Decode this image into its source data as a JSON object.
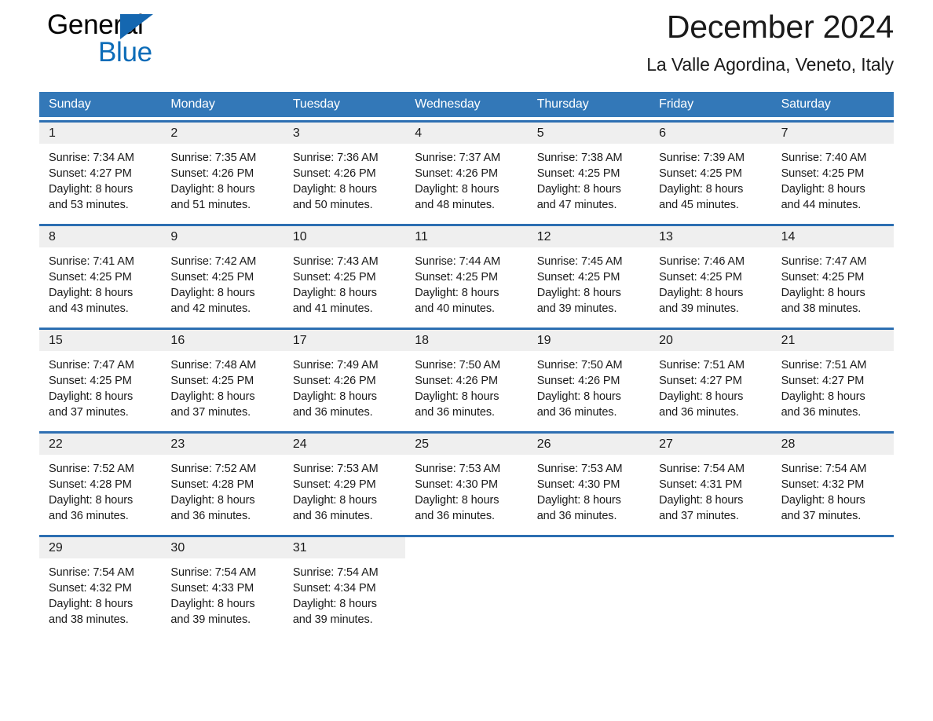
{
  "brand": {
    "name_part1": "General",
    "name_part2": "Blue",
    "triangle_color": "#1567b0",
    "blue_color": "#0c6cb8"
  },
  "header": {
    "title": "December 2024",
    "subtitle": "La Valle Agordina, Veneto, Italy"
  },
  "theme": {
    "header_bar_color": "#3378b8",
    "week_rule_color": "#2d6fb2",
    "daynum_band_color": "#efefef"
  },
  "calendar": {
    "weekdays": [
      "Sunday",
      "Monday",
      "Tuesday",
      "Wednesday",
      "Thursday",
      "Friday",
      "Saturday"
    ],
    "weeks": [
      [
        {
          "day": "1",
          "sunrise": "Sunrise: 7:34 AM",
          "sunset": "Sunset: 4:27 PM",
          "daylight": "Daylight: 8 hours and 53 minutes."
        },
        {
          "day": "2",
          "sunrise": "Sunrise: 7:35 AM",
          "sunset": "Sunset: 4:26 PM",
          "daylight": "Daylight: 8 hours and 51 minutes."
        },
        {
          "day": "3",
          "sunrise": "Sunrise: 7:36 AM",
          "sunset": "Sunset: 4:26 PM",
          "daylight": "Daylight: 8 hours and 50 minutes."
        },
        {
          "day": "4",
          "sunrise": "Sunrise: 7:37 AM",
          "sunset": "Sunset: 4:26 PM",
          "daylight": "Daylight: 8 hours and 48 minutes."
        },
        {
          "day": "5",
          "sunrise": "Sunrise: 7:38 AM",
          "sunset": "Sunset: 4:25 PM",
          "daylight": "Daylight: 8 hours and 47 minutes."
        },
        {
          "day": "6",
          "sunrise": "Sunrise: 7:39 AM",
          "sunset": "Sunset: 4:25 PM",
          "daylight": "Daylight: 8 hours and 45 minutes."
        },
        {
          "day": "7",
          "sunrise": "Sunrise: 7:40 AM",
          "sunset": "Sunset: 4:25 PM",
          "daylight": "Daylight: 8 hours and 44 minutes."
        }
      ],
      [
        {
          "day": "8",
          "sunrise": "Sunrise: 7:41 AM",
          "sunset": "Sunset: 4:25 PM",
          "daylight": "Daylight: 8 hours and 43 minutes."
        },
        {
          "day": "9",
          "sunrise": "Sunrise: 7:42 AM",
          "sunset": "Sunset: 4:25 PM",
          "daylight": "Daylight: 8 hours and 42 minutes."
        },
        {
          "day": "10",
          "sunrise": "Sunrise: 7:43 AM",
          "sunset": "Sunset: 4:25 PM",
          "daylight": "Daylight: 8 hours and 41 minutes."
        },
        {
          "day": "11",
          "sunrise": "Sunrise: 7:44 AM",
          "sunset": "Sunset: 4:25 PM",
          "daylight": "Daylight: 8 hours and 40 minutes."
        },
        {
          "day": "12",
          "sunrise": "Sunrise: 7:45 AM",
          "sunset": "Sunset: 4:25 PM",
          "daylight": "Daylight: 8 hours and 39 minutes."
        },
        {
          "day": "13",
          "sunrise": "Sunrise: 7:46 AM",
          "sunset": "Sunset: 4:25 PM",
          "daylight": "Daylight: 8 hours and 39 minutes."
        },
        {
          "day": "14",
          "sunrise": "Sunrise: 7:47 AM",
          "sunset": "Sunset: 4:25 PM",
          "daylight": "Daylight: 8 hours and 38 minutes."
        }
      ],
      [
        {
          "day": "15",
          "sunrise": "Sunrise: 7:47 AM",
          "sunset": "Sunset: 4:25 PM",
          "daylight": "Daylight: 8 hours and 37 minutes."
        },
        {
          "day": "16",
          "sunrise": "Sunrise: 7:48 AM",
          "sunset": "Sunset: 4:25 PM",
          "daylight": "Daylight: 8 hours and 37 minutes."
        },
        {
          "day": "17",
          "sunrise": "Sunrise: 7:49 AM",
          "sunset": "Sunset: 4:26 PM",
          "daylight": "Daylight: 8 hours and 36 minutes."
        },
        {
          "day": "18",
          "sunrise": "Sunrise: 7:50 AM",
          "sunset": "Sunset: 4:26 PM",
          "daylight": "Daylight: 8 hours and 36 minutes."
        },
        {
          "day": "19",
          "sunrise": "Sunrise: 7:50 AM",
          "sunset": "Sunset: 4:26 PM",
          "daylight": "Daylight: 8 hours and 36 minutes."
        },
        {
          "day": "20",
          "sunrise": "Sunrise: 7:51 AM",
          "sunset": "Sunset: 4:27 PM",
          "daylight": "Daylight: 8 hours and 36 minutes."
        },
        {
          "day": "21",
          "sunrise": "Sunrise: 7:51 AM",
          "sunset": "Sunset: 4:27 PM",
          "daylight": "Daylight: 8 hours and 36 minutes."
        }
      ],
      [
        {
          "day": "22",
          "sunrise": "Sunrise: 7:52 AM",
          "sunset": "Sunset: 4:28 PM",
          "daylight": "Daylight: 8 hours and 36 minutes."
        },
        {
          "day": "23",
          "sunrise": "Sunrise: 7:52 AM",
          "sunset": "Sunset: 4:28 PM",
          "daylight": "Daylight: 8 hours and 36 minutes."
        },
        {
          "day": "24",
          "sunrise": "Sunrise: 7:53 AM",
          "sunset": "Sunset: 4:29 PM",
          "daylight": "Daylight: 8 hours and 36 minutes."
        },
        {
          "day": "25",
          "sunrise": "Sunrise: 7:53 AM",
          "sunset": "Sunset: 4:30 PM",
          "daylight": "Daylight: 8 hours and 36 minutes."
        },
        {
          "day": "26",
          "sunrise": "Sunrise: 7:53 AM",
          "sunset": "Sunset: 4:30 PM",
          "daylight": "Daylight: 8 hours and 36 minutes."
        },
        {
          "day": "27",
          "sunrise": "Sunrise: 7:54 AM",
          "sunset": "Sunset: 4:31 PM",
          "daylight": "Daylight: 8 hours and 37 minutes."
        },
        {
          "day": "28",
          "sunrise": "Sunrise: 7:54 AM",
          "sunset": "Sunset: 4:32 PM",
          "daylight": "Daylight: 8 hours and 37 minutes."
        }
      ],
      [
        {
          "day": "29",
          "sunrise": "Sunrise: 7:54 AM",
          "sunset": "Sunset: 4:32 PM",
          "daylight": "Daylight: 8 hours and 38 minutes."
        },
        {
          "day": "30",
          "sunrise": "Sunrise: 7:54 AM",
          "sunset": "Sunset: 4:33 PM",
          "daylight": "Daylight: 8 hours and 39 minutes."
        },
        {
          "day": "31",
          "sunrise": "Sunrise: 7:54 AM",
          "sunset": "Sunset: 4:34 PM",
          "daylight": "Daylight: 8 hours and 39 minutes."
        },
        {
          "day": "",
          "sunrise": "",
          "sunset": "",
          "daylight": ""
        },
        {
          "day": "",
          "sunrise": "",
          "sunset": "",
          "daylight": ""
        },
        {
          "day": "",
          "sunrise": "",
          "sunset": "",
          "daylight": ""
        },
        {
          "day": "",
          "sunrise": "",
          "sunset": "",
          "daylight": ""
        }
      ]
    ]
  }
}
